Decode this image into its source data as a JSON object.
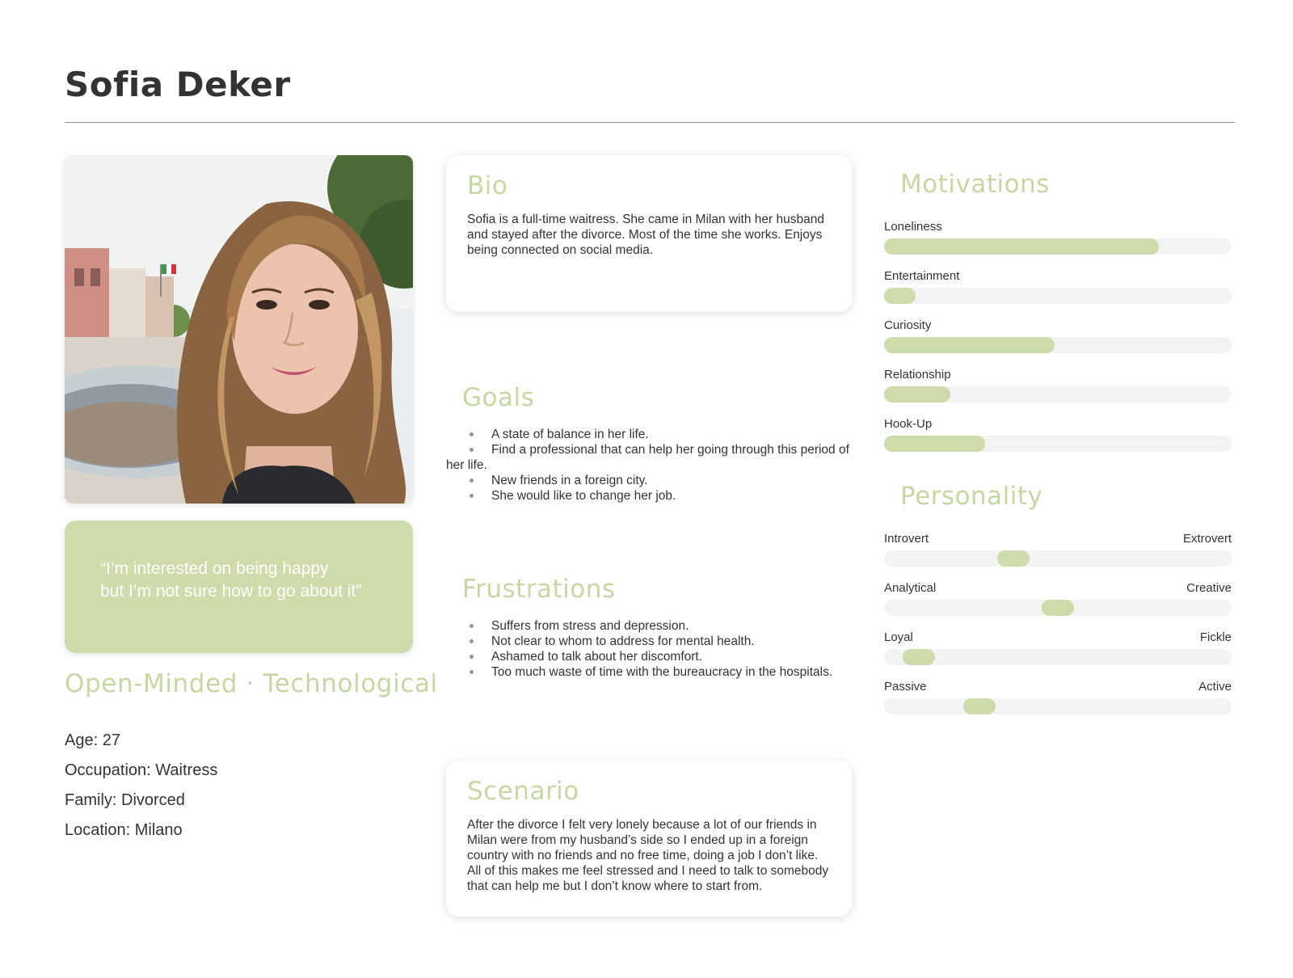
{
  "persona": {
    "name": "Sofia Deker"
  },
  "photo": {
    "alt": "Portrait selfie of Sofia in a town square"
  },
  "quote": {
    "line1": "“I’m interested on being happy",
    "line2": "but I’m not sure how to go about it”"
  },
  "traits": "Open-Minded · Technological",
  "facts": {
    "age": "Age: 27",
    "occupation": "Occupation: Waitress",
    "family": "Family: Divorced",
    "location": "Location: Milano"
  },
  "bio": {
    "title": "Bio",
    "text": "Sofia is a full-time waitress. She came in Milan with her husband and stayed after the divorce. Most of the time she works. Enjoys being connected on social media."
  },
  "goals": {
    "title": "Goals",
    "items": [
      "A state of balance in her life.",
      "Find a professional that can help her going through this period of her life.",
      "New friends in a foreign city.",
      "She would like to change her job."
    ]
  },
  "frustrations": {
    "title": "Frustrations",
    "items": [
      "Suffers from stress and depression.",
      "Not clear to whom to address for mental health.",
      "Ashamed to talk about her discomfort.",
      "Too much waste of time with the bureaucracy in the hospitals."
    ]
  },
  "scenario": {
    "title": "Scenario",
    "text": "After the divorce I felt very lonely because a lot of our friends in Milan were from my husband’s side so I ended up in a foreign country with no friends and no free time, doing a job I don’t like. All of this makes me feel stressed and I need to talk to somebody that can help me but I don’t know where to start from."
  },
  "motivations": {
    "title": "Motivations",
    "items": [
      {
        "label": "Loneliness",
        "level": 0.79
      },
      {
        "label": "Entertainment",
        "level": 0.09
      },
      {
        "label": "Curiosity",
        "level": 0.49
      },
      {
        "label": "Relationship",
        "level": 0.19
      },
      {
        "label": "Hook-Up",
        "level": 0.29
      }
    ]
  },
  "personality": {
    "title": "Personality",
    "items": [
      {
        "left": "Introvert",
        "right": "Extrovert",
        "level": 0.36
      },
      {
        "left": "Analytical",
        "right": "Creative",
        "level": 0.5
      },
      {
        "left": "Loyal",
        "right": "Fickle",
        "level": 0.06
      },
      {
        "left": "Passive",
        "right": "Active",
        "level": 0.25
      }
    ]
  },
  "colors": {
    "accent": "#c6d8a1",
    "accent_fill": "#cddcaa",
    "text": "#333333",
    "track": "#f3f3f3"
  }
}
